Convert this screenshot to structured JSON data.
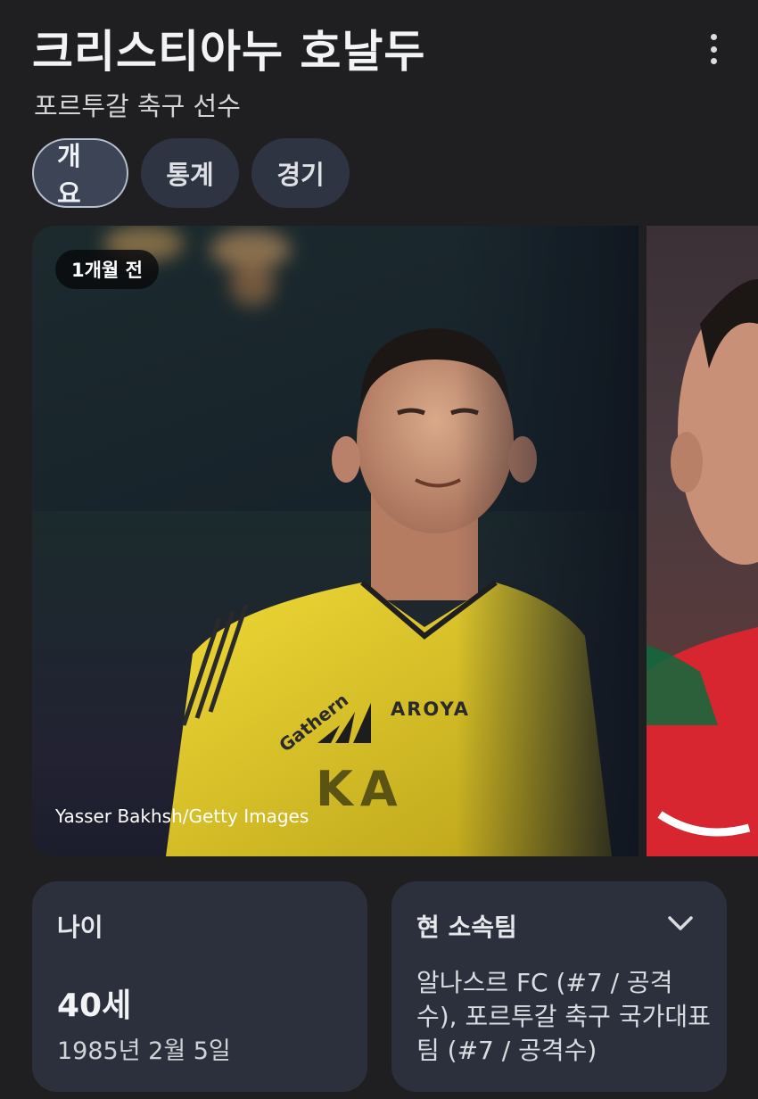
{
  "header": {
    "title": "크리스티아누 호날두",
    "subtitle": "포르투갈 축구 선수",
    "more_icon": "more-vert-icon"
  },
  "tabs": [
    {
      "label": "개요",
      "active": true
    },
    {
      "label": "통계",
      "active": false
    },
    {
      "label": "경기",
      "active": false
    }
  ],
  "gallery": {
    "main_photo": {
      "time_badge": "1개월 전",
      "credit": "Yasser Bakhsh/Getty Images",
      "jersey_text": [
        "Gathern",
        "AROYA",
        "KA"
      ]
    }
  },
  "cards": {
    "age": {
      "label": "나이",
      "value": "40세",
      "birthdate": "1985년 2월 5일"
    },
    "team": {
      "label": "현 소속팀",
      "value": "알나스르 FC (#7 / 공격수), 포르투갈 축구 국가대표팀 (#7 / 공격수)",
      "expand_icon": "chevron-down-icon"
    }
  },
  "colors": {
    "background": "#1f1f21",
    "card": "#2c303c",
    "tab": "#2f3442",
    "tab_active_border": "#b7bfcc",
    "jersey_yellow": "#e8d020",
    "jersey_red": "#d7262f"
  }
}
